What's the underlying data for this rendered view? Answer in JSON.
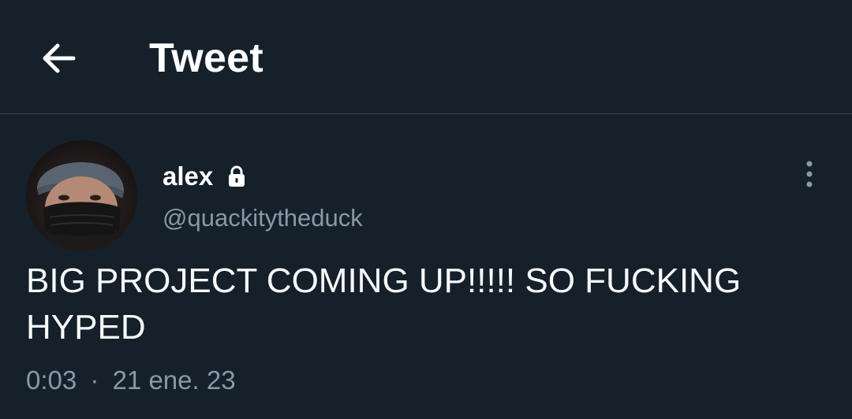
{
  "header": {
    "title": "Tweet",
    "back_icon": "arrow-left-icon"
  },
  "tweet": {
    "author": {
      "name": "alex",
      "handle": "@quackitytheduck",
      "protected_icon": "lock-icon",
      "avatar": "profile-photo"
    },
    "text": "BIG PROJECT COMING UP!!!!! SO FUCKING\nHYPED",
    "time": "0:03",
    "separator": "·",
    "date": "21 ene. 23",
    "more_icon": "more-vertical-icon"
  },
  "colors": {
    "background": "#15202b",
    "divider": "#38444d",
    "primary_text": "#ffffff",
    "secondary_text": "#8b98a5"
  }
}
